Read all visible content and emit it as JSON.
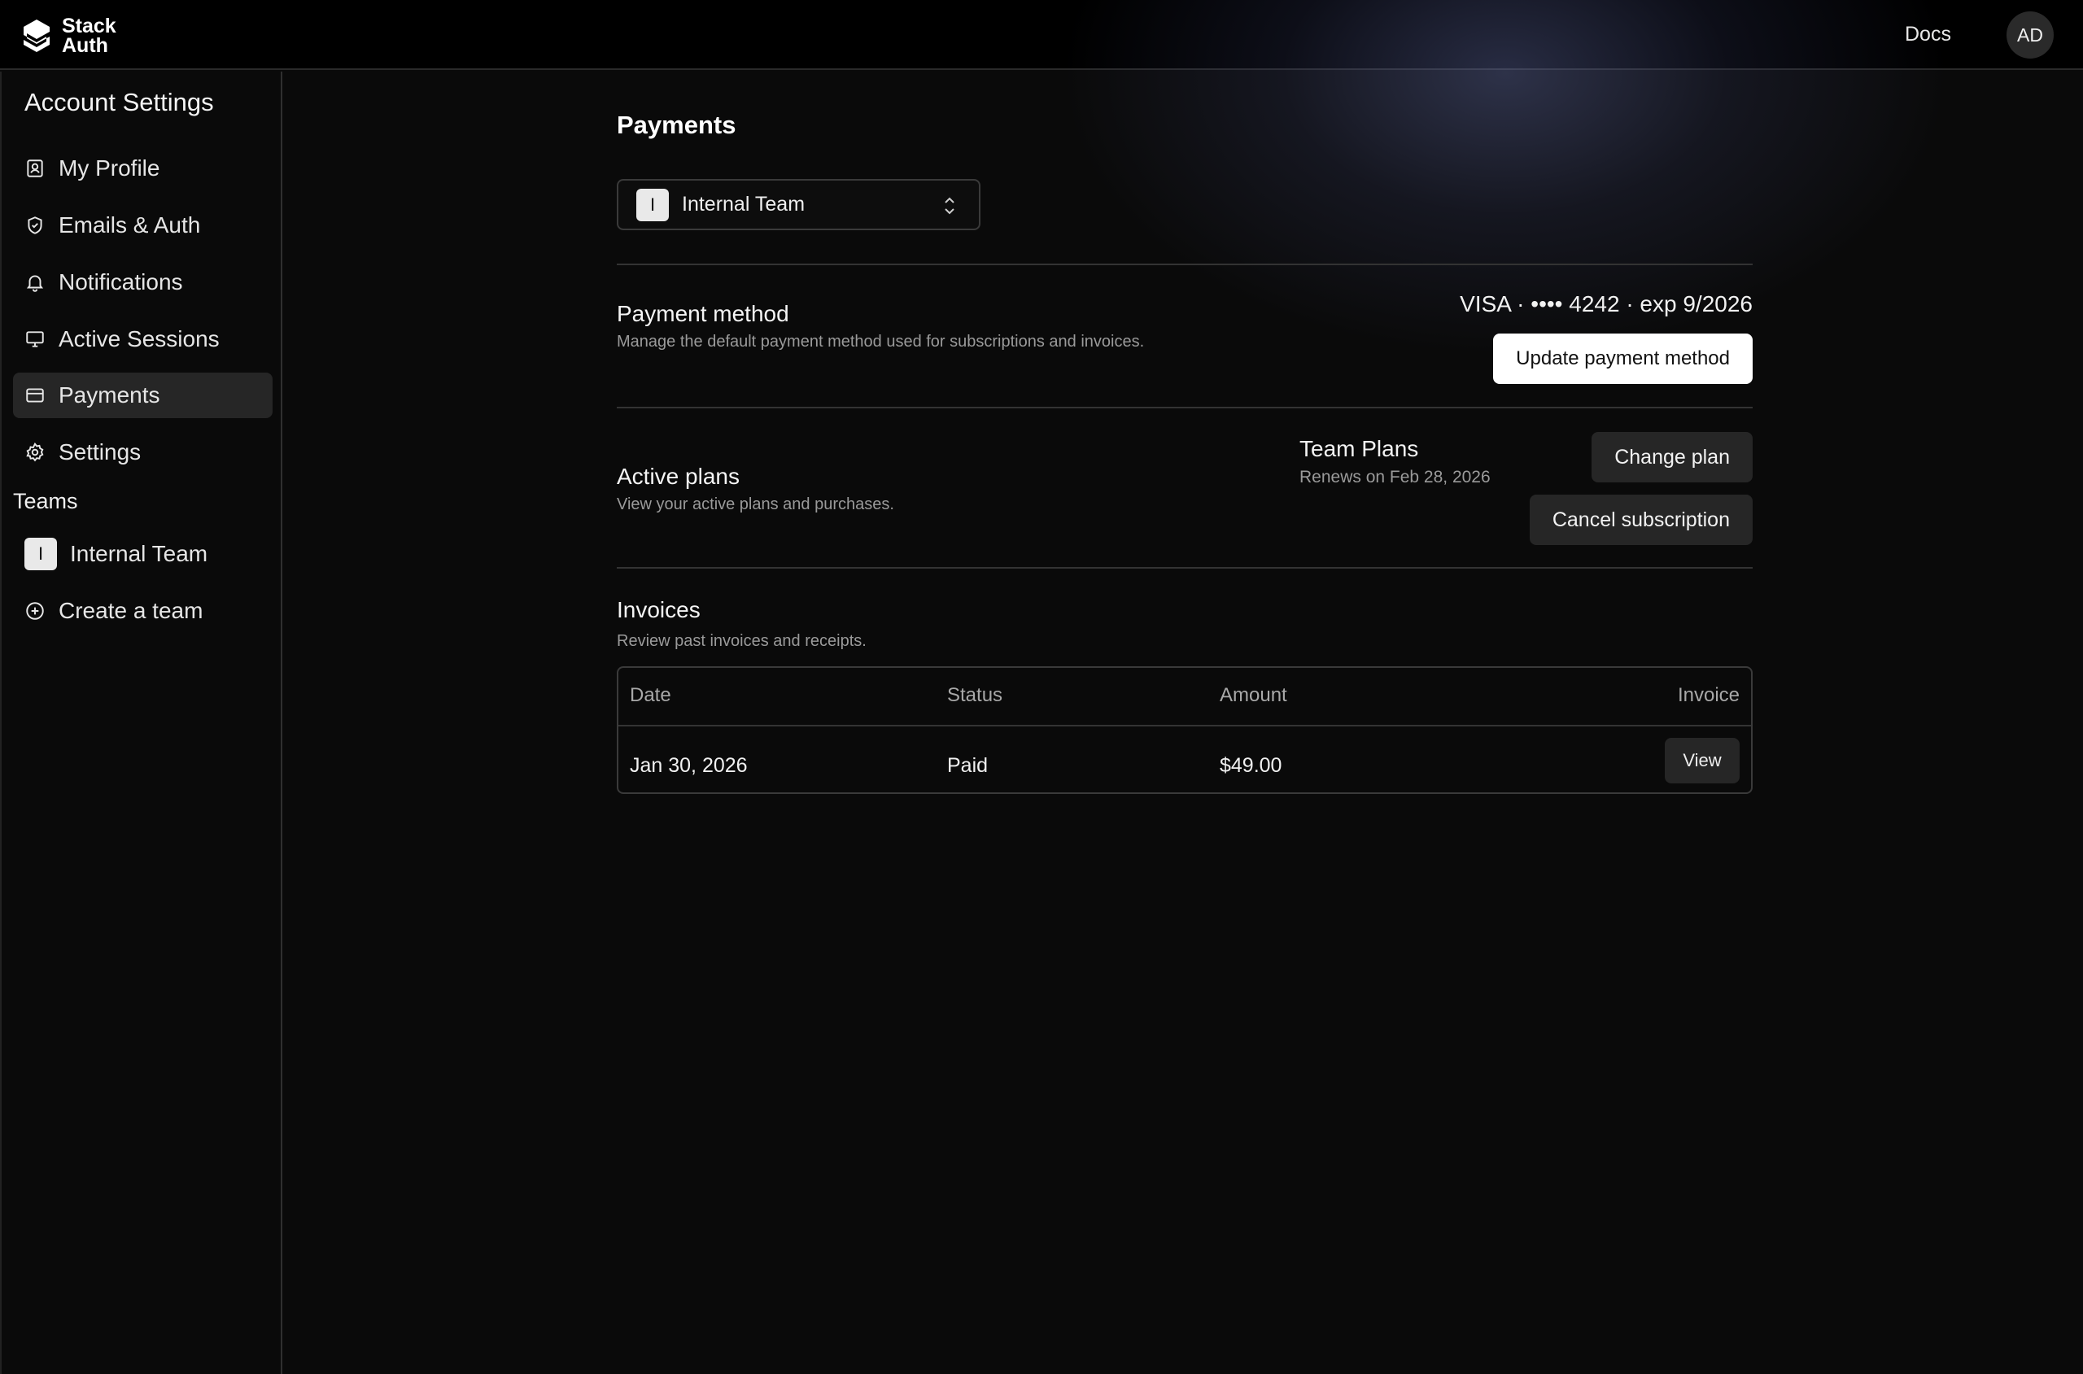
{
  "header": {
    "logo_line1": "Stack",
    "logo_line2": "Auth",
    "docs_label": "Docs",
    "avatar_initials": "AD"
  },
  "sidebar": {
    "title": "Account Settings",
    "items": [
      {
        "label": "My Profile",
        "icon": "profile-icon"
      },
      {
        "label": "Emails & Auth",
        "icon": "shield-icon"
      },
      {
        "label": "Notifications",
        "icon": "bell-icon"
      },
      {
        "label": "Active Sessions",
        "icon": "monitor-icon"
      },
      {
        "label": "Payments",
        "icon": "credit-card-icon",
        "active": true
      },
      {
        "label": "Settings",
        "icon": "gear-icon"
      }
    ],
    "teams_label": "Teams",
    "team": {
      "initial": "I",
      "name": "Internal Team"
    },
    "create_team_label": "Create a team"
  },
  "main": {
    "title": "Payments",
    "team_select": {
      "initial": "I",
      "value": "Internal Team"
    },
    "payment_method": {
      "title": "Payment method",
      "description": "Manage the default payment method used for subscriptions and invoices.",
      "card_info": "VISA · •••• 4242 · exp 9/2026",
      "update_button": "Update payment method"
    },
    "active_plans": {
      "title": "Active plans",
      "description": "View your active plans and purchases.",
      "plan_name": "Team Plans",
      "renews": "Renews on Feb 28, 2026",
      "change_button": "Change plan",
      "cancel_button": "Cancel subscription"
    },
    "invoices": {
      "title": "Invoices",
      "description": "Review past invoices and receipts.",
      "columns": [
        "Date",
        "Status",
        "Amount",
        "Invoice"
      ],
      "rows": [
        {
          "date": "Jan 30, 2026",
          "status": "Paid",
          "amount": "$49.00",
          "action": "View"
        }
      ]
    }
  },
  "colors": {
    "background": "#0a0a0a",
    "topbar": "#000000",
    "active_nav": "#262626",
    "muted_text": "#9a9a9a",
    "primary_button": "#ffffff"
  }
}
